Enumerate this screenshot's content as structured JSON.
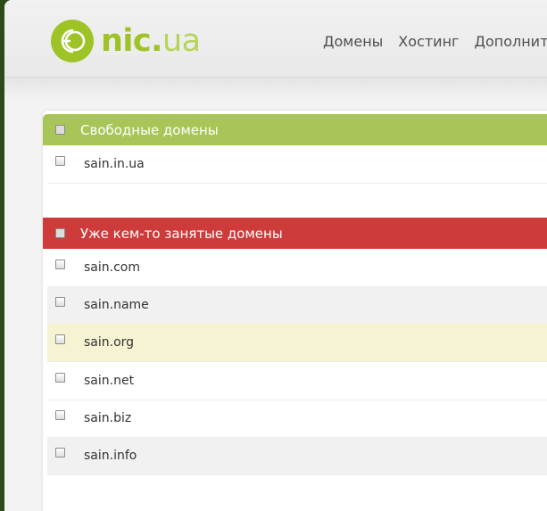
{
  "logo": {
    "name": "nic",
    "dot": ".",
    "tld": "ua"
  },
  "nav": [
    "Домены",
    "Хостинг",
    "Дополнит"
  ],
  "free_section": {
    "title": "Свободные домены",
    "domains": [
      "sain.in.ua"
    ]
  },
  "taken_section": {
    "title": "Уже кем-то занятые домены",
    "domains": [
      "sain.com",
      "sain.name",
      "sain.org",
      "sain.net",
      "sain.biz",
      "sain.info"
    ]
  },
  "colors": {
    "brand_green": "#9ec326",
    "free_header": "#a8c657",
    "taken_header": "#cd3b3b",
    "highlight_row": "#f6f3d2"
  },
  "icons": [
    "logo-mark-icon"
  ]
}
